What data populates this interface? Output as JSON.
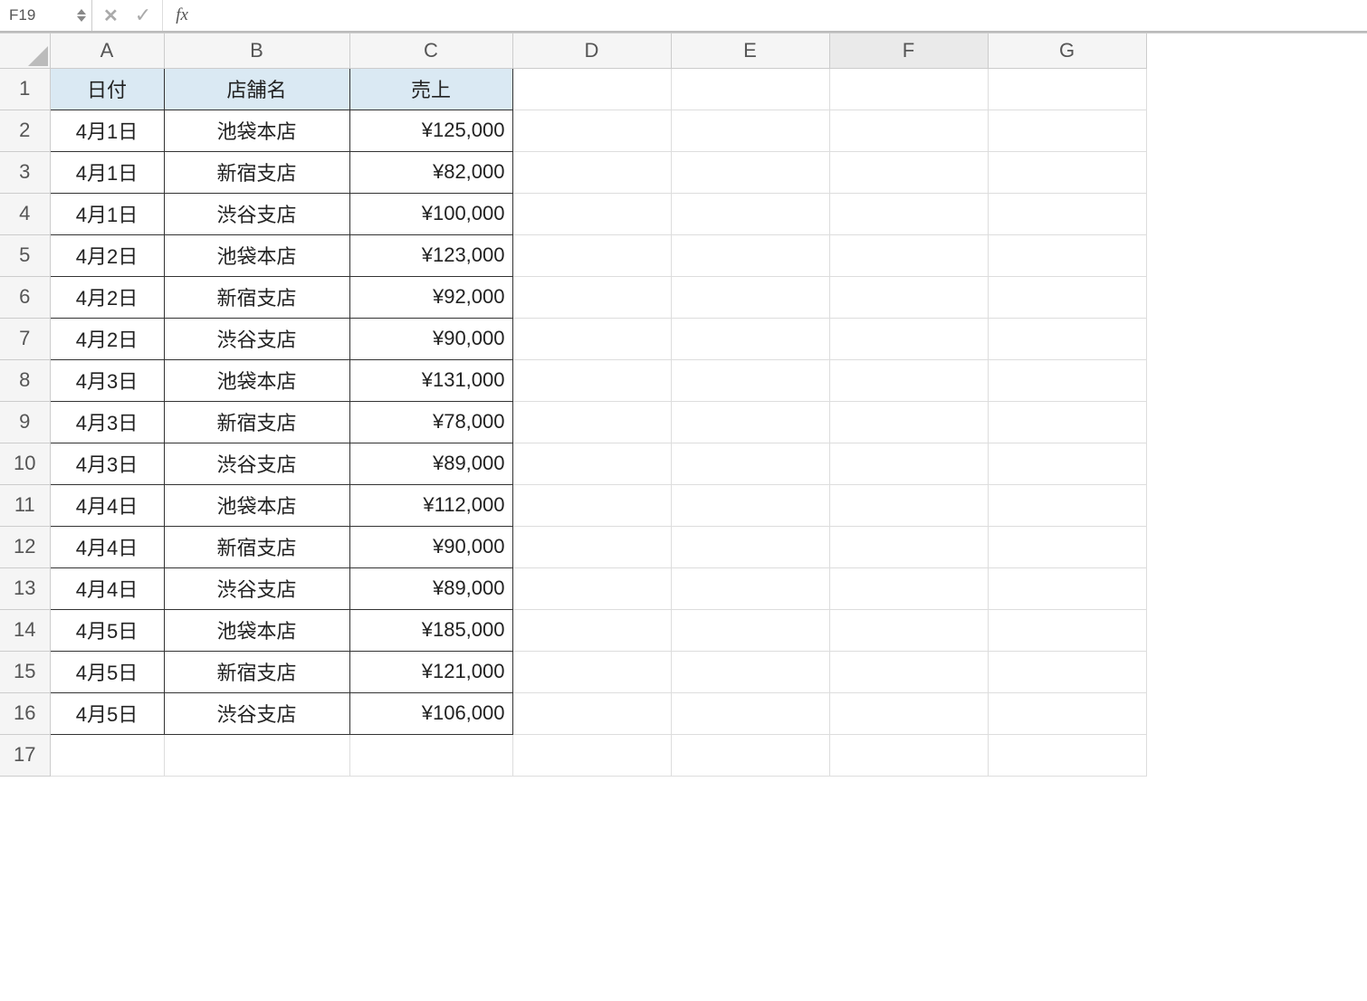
{
  "formulaBar": {
    "nameBox": "F19",
    "fxLabel": "fx",
    "formulaValue": ""
  },
  "columnHeaders": [
    "A",
    "B",
    "C",
    "D",
    "E",
    "F",
    "G"
  ],
  "selectedColumn": "F",
  "rowHeaders": [
    "1",
    "2",
    "3",
    "4",
    "5",
    "6",
    "7",
    "8",
    "9",
    "10",
    "11",
    "12",
    "13",
    "14",
    "15",
    "16",
    "17"
  ],
  "tableHeaders": {
    "A": "日付",
    "B": "店舗名",
    "C": "売上"
  },
  "rows": [
    {
      "A": "4月1日",
      "B": "池袋本店",
      "C": "¥125,000"
    },
    {
      "A": "4月1日",
      "B": "新宿支店",
      "C": "¥82,000"
    },
    {
      "A": "4月1日",
      "B": "渋谷支店",
      "C": "¥100,000"
    },
    {
      "A": "4月2日",
      "B": "池袋本店",
      "C": "¥123,000"
    },
    {
      "A": "4月2日",
      "B": "新宿支店",
      "C": "¥92,000"
    },
    {
      "A": "4月2日",
      "B": "渋谷支店",
      "C": "¥90,000"
    },
    {
      "A": "4月3日",
      "B": "池袋本店",
      "C": "¥131,000"
    },
    {
      "A": "4月3日",
      "B": "新宿支店",
      "C": "¥78,000"
    },
    {
      "A": "4月3日",
      "B": "渋谷支店",
      "C": "¥89,000"
    },
    {
      "A": "4月4日",
      "B": "池袋本店",
      "C": "¥112,000"
    },
    {
      "A": "4月4日",
      "B": "新宿支店",
      "C": "¥90,000"
    },
    {
      "A": "4月4日",
      "B": "渋谷支店",
      "C": "¥89,000"
    },
    {
      "A": "4月5日",
      "B": "池袋本店",
      "C": "¥185,000"
    },
    {
      "A": "4月5日",
      "B": "新宿支店",
      "C": "¥121,000"
    },
    {
      "A": "4月5日",
      "B": "渋谷支店",
      "C": "¥106,000"
    }
  ]
}
